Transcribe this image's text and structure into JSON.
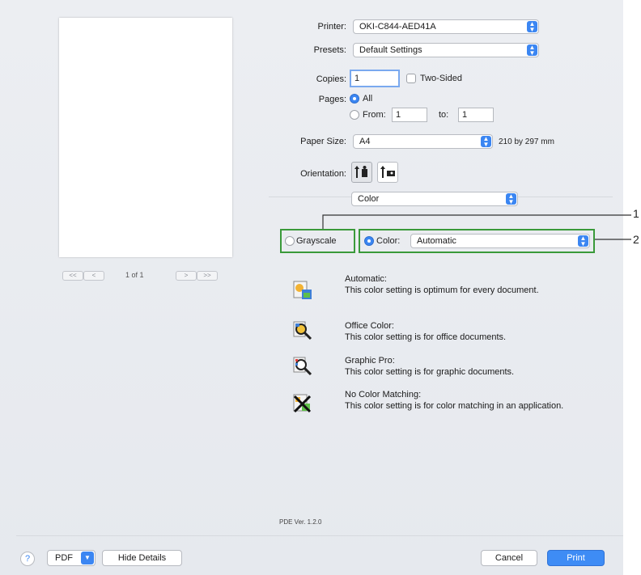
{
  "preview": {
    "page_indicator": "1 of 1",
    "first_label": "<<",
    "prev_label": "<",
    "next_label": ">",
    "last_label": ">>"
  },
  "printer": {
    "label": "Printer:",
    "value": "OKI-C844-AED41A"
  },
  "presets": {
    "label": "Presets:",
    "value": "Default Settings"
  },
  "copies": {
    "label": "Copies:",
    "value": "1",
    "two_sided_label": "Two-Sided"
  },
  "pages": {
    "label": "Pages:",
    "all_label": "All",
    "from_label": "From:",
    "from_value": "1",
    "to_label": "to:",
    "to_value": "1"
  },
  "paper_size": {
    "label": "Paper Size:",
    "value": "A4",
    "dimensions": "210 by 297 mm"
  },
  "orientation": {
    "label": "Orientation:"
  },
  "section_popup": {
    "value": "Color"
  },
  "color_mode": {
    "grayscale_label": "Grayscale",
    "color_label": "Color:",
    "color_value": "Automatic"
  },
  "callouts": [
    "1",
    "2"
  ],
  "descriptions": [
    {
      "title": "Automatic:",
      "text": "This color setting is optimum for every document.",
      "icon": "auto-color-icon"
    },
    {
      "title": "Office Color:",
      "text": "This color setting is for office documents.",
      "icon": "office-color-icon"
    },
    {
      "title": "Graphic Pro:",
      "text": "This color setting is for graphic documents.",
      "icon": "graphic-pro-icon"
    },
    {
      "title": "No Color Matching:",
      "text": "This color setting is for color matching in an application.",
      "icon": "no-color-matching-icon"
    }
  ],
  "version": "PDE Ver. 1.2.0",
  "footer": {
    "help_label": "?",
    "pdf_label": "PDF",
    "hide_details_label": "Hide Details",
    "cancel_label": "Cancel",
    "print_label": "Print"
  },
  "colors": {
    "accent": "#3b86f2",
    "highlight_border": "#3a9a3a"
  }
}
